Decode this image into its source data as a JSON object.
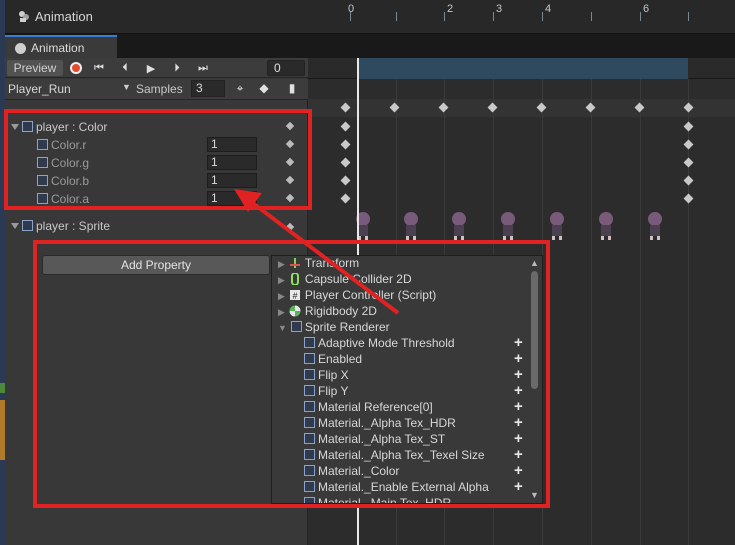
{
  "window": {
    "title": "Animation",
    "tab": "Animation"
  },
  "toolbar": {
    "preview_label": "Preview",
    "frame_value": "0",
    "clip_name": "Player_Run",
    "samples_label": "Samples",
    "samples_value": "3"
  },
  "ruler": {
    "labels": [
      "0",
      "2",
      "3",
      "4",
      "6"
    ]
  },
  "properties": {
    "color_group": "player : Color",
    "sprite_group": "player : Sprite",
    "channels": [
      {
        "label": "Color.r",
        "value": "1"
      },
      {
        "label": "Color.g",
        "value": "1"
      },
      {
        "label": "Color.b",
        "value": "1"
      },
      {
        "label": "Color.a",
        "value": "1"
      }
    ]
  },
  "add_property": {
    "button_label": "Add Property",
    "components": [
      "Transform",
      "Capsule Collider 2D",
      "Player Controller (Script)",
      "Rigidbody 2D",
      "Sprite Renderer"
    ],
    "sprite_renderer_props": [
      "Adaptive Mode Threshold",
      "Enabled",
      "Flip X",
      "Flip Y",
      "Material Reference[0]",
      "Material._Alpha Tex_HDR",
      "Material._Alpha Tex_ST",
      "Material._Alpha Tex_Texel Size",
      "Material._Color",
      "Material._Enable External Alpha",
      "Material._Main Tex_HDR"
    ],
    "plus": "+"
  },
  "colors": {
    "record": "#e24b2e",
    "annotation": "#e02222",
    "playhead": "#e8e8e8"
  }
}
